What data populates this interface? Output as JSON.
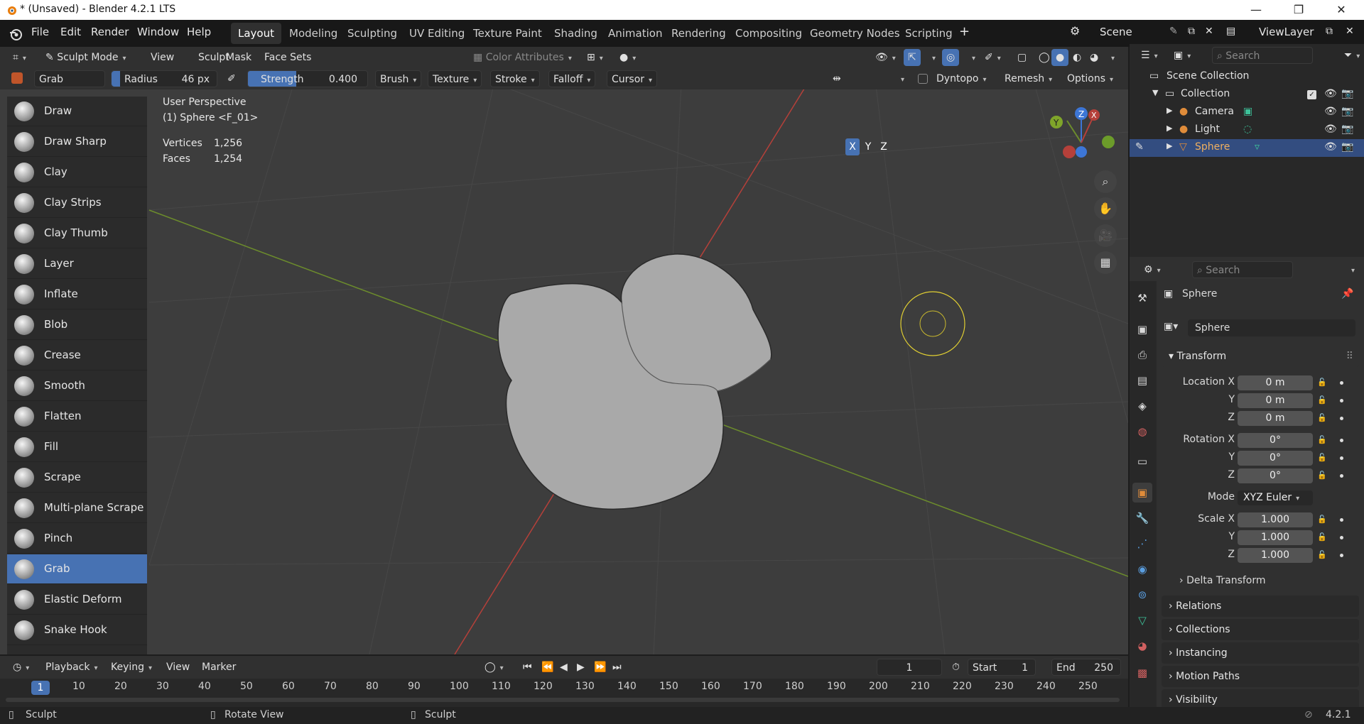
{
  "window": {
    "title": "* (Unsaved) - Blender 4.2.1 LTS",
    "minimize": "—",
    "restore": "❐",
    "close": "✕"
  },
  "menu": [
    "File",
    "Edit",
    "Render",
    "Window",
    "Help"
  ],
  "workspaces": [
    "Layout",
    "Modeling",
    "Sculpting",
    "UV Editing",
    "Texture Paint",
    "Shading",
    "Animation",
    "Rendering",
    "Compositing",
    "Geometry Nodes",
    "Scripting"
  ],
  "active_workspace": "Layout",
  "scene": "Scene",
  "view_layer": "ViewLayer",
  "header": {
    "mode": "Sculpt Mode",
    "menus": [
      "View",
      "Sculpt",
      "Mask",
      "Face Sets"
    ],
    "color_attributes": "Color Attributes",
    "dyntopo": "Dyntopo",
    "remesh": "Remesh",
    "options": "Options",
    "axes": [
      "X",
      "Y",
      "Z"
    ]
  },
  "tool_settings": {
    "brush_name": "Grab",
    "radius_label": "Radius",
    "radius_value": "46 px",
    "strength_label": "Strength",
    "strength_value": "0.400",
    "strength_fraction": 0.4,
    "dropdowns": [
      "Brush",
      "Texture",
      "Stroke",
      "Falloff",
      "Cursor"
    ]
  },
  "viewport": {
    "perspective": "User Perspective",
    "object": "(1) Sphere <F_01>",
    "stats": [
      {
        "label": "Vertices",
        "value": "1,256"
      },
      {
        "label": "Faces",
        "value": "1,254"
      }
    ]
  },
  "brushes": [
    "Draw",
    "Draw Sharp",
    "Clay",
    "Clay Strips",
    "Clay Thumb",
    "Layer",
    "Inflate",
    "Blob",
    "Crease",
    "Smooth",
    "Flatten",
    "Fill",
    "Scrape",
    "Multi-plane Scrape",
    "Pinch",
    "Grab",
    "Elastic Deform",
    "Snake Hook"
  ],
  "selected_brush": "Grab",
  "timeline": {
    "menus": [
      "Playback",
      "Keying",
      "View",
      "Marker"
    ],
    "current_frame": "1",
    "start_label": "Start",
    "start": "1",
    "end_label": "End",
    "end": "250",
    "ticks": [
      "10",
      "20",
      "30",
      "40",
      "50",
      "60",
      "70",
      "80",
      "90",
      "100",
      "110",
      "120",
      "130",
      "140",
      "150",
      "160",
      "170",
      "180",
      "190",
      "200",
      "210",
      "220",
      "230",
      "240",
      "250"
    ]
  },
  "outliner": {
    "search_placeholder": "Search",
    "root": "Scene Collection",
    "collection": "Collection",
    "items": [
      "Camera",
      "Light",
      "Sphere"
    ]
  },
  "properties": {
    "search_placeholder": "Search",
    "object_name": "Sphere",
    "data_name": "Sphere",
    "transform_label": "Transform",
    "location": {
      "label": "Location X",
      "x": "0 m",
      "y": "0 m",
      "z": "0 m"
    },
    "rotation": {
      "label": "Rotation X",
      "x": "0°",
      "y": "0°",
      "z": "0°"
    },
    "mode_label": "Mode",
    "mode_value": "XYZ Euler",
    "scale": {
      "label": "Scale X",
      "x": "1.000",
      "y": "1.000",
      "z": "1.000"
    },
    "axis_y": "Y",
    "axis_z": "Z",
    "delta_transform": "Delta Transform",
    "sections": [
      "Relations",
      "Collections",
      "Instancing",
      "Motion Paths",
      "Visibility"
    ]
  },
  "status": {
    "left": "Sculpt",
    "middle": "Rotate View",
    "right": "Sculpt",
    "version": "4.2.1"
  },
  "colors": {
    "accent": "#4772b3",
    "x_axis": "#c0392b",
    "y_axis": "#7fa52a",
    "z_axis": "#3d76d6",
    "cursor": "#e1cf32"
  }
}
